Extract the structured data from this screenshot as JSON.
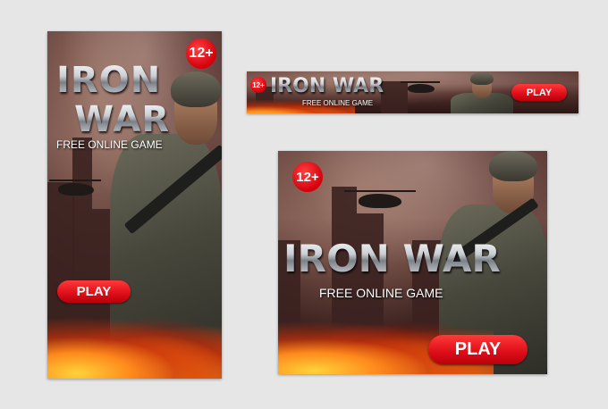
{
  "colors": {
    "background": "#e6e6e6",
    "play_button": "#e0101a",
    "age_badge": "#d3000c"
  },
  "ads": [
    {
      "id": "tall",
      "age_rating": "12+",
      "title_line1": "IRON",
      "title_line2": "WAR",
      "subtitle": "FREE ONLINE GAME",
      "play_label": "PLAY"
    },
    {
      "id": "leaderboard",
      "age_rating": "12+",
      "title": "IRON WAR",
      "subtitle": "FREE ONLINE GAME",
      "play_label": "PLAY"
    },
    {
      "id": "square",
      "age_rating": "12+",
      "title": "IRON WAR",
      "subtitle": "FREE ONLINE GAME",
      "play_label": "PLAY"
    }
  ]
}
